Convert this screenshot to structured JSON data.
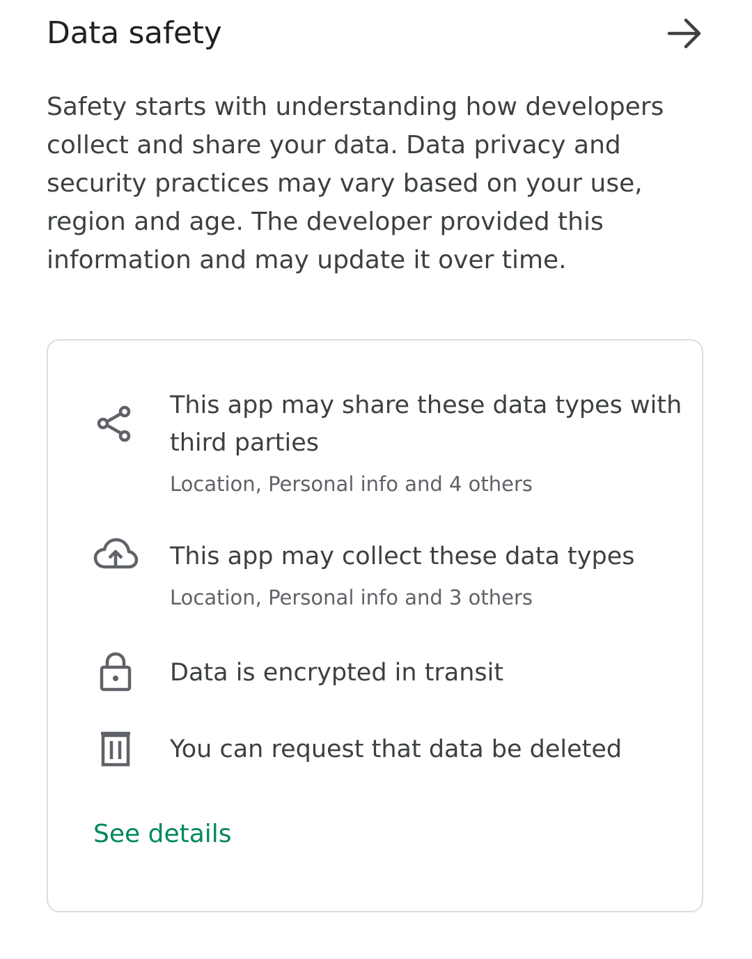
{
  "section": {
    "title": "Data safety",
    "description": "Safety starts with understanding how developers collect and share your data. Data privacy and security practices may vary based on your use, region and age. The developer provided this information and may update it over time."
  },
  "card": {
    "items": [
      {
        "icon": "share-icon",
        "title": "This app may share these data types with third parties",
        "subtitle": "Location, Personal info and 4 others"
      },
      {
        "icon": "cloud-upload-icon",
        "title": "This app may collect these data types",
        "subtitle": "Location, Personal info and 3 others"
      },
      {
        "icon": "lock-icon",
        "title": "Data is encrypted in transit"
      },
      {
        "icon": "trash-icon",
        "title": "You can request that data be deleted"
      }
    ],
    "see_details_label": "See details"
  },
  "colors": {
    "accent": "#01875f",
    "text_primary": "#202124",
    "text_secondary": "#5f6368",
    "border": "#dadce0"
  }
}
